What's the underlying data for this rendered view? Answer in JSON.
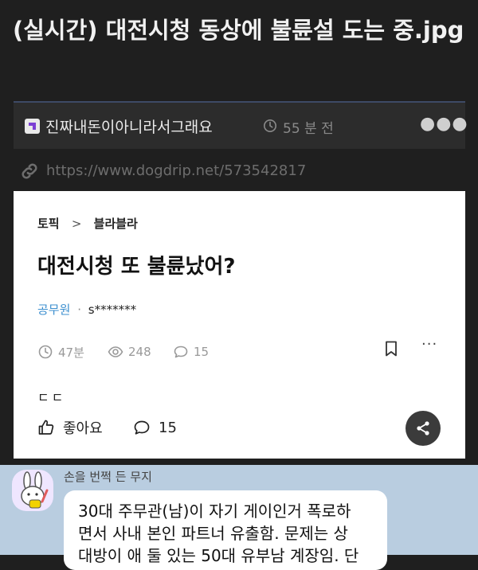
{
  "post": {
    "title": "(실시간) 대전시청 동상에 불륜설 도는 중.jpg"
  },
  "meta": {
    "board_name": "진짜내돈이아니라서그래요",
    "time_ago": "55 분 전",
    "more_label": "●●●"
  },
  "link": {
    "url": "https://www.dogdrip.net/573542817"
  },
  "embedded": {
    "breadcrumb_topic": "토픽",
    "breadcrumb_separator": ">",
    "breadcrumb_category": "블라블라",
    "title": "대전시청 또 불륜났어?",
    "author_group": "공무원",
    "author_dot": "·",
    "author_name": "s*******",
    "stats": {
      "time": "47분",
      "views": "248",
      "comments": "15"
    },
    "more_label": "···",
    "body_start": "ㄷㄷ",
    "like_label": "좋아요",
    "comment_count": "15",
    "colors": {
      "author_group": "#3c8fcf",
      "share_button": "#3b3b3b"
    }
  },
  "chat": {
    "sender": "손을 번쩍 든 무지",
    "lines": [
      "30대 주무관(남)이 자기 게이인거 폭로하",
      "면서 사내 본인 파트너 유출함. 문제는 상",
      "대방이 애 둘 있는 50대 유부남 계장임. 단"
    ]
  }
}
